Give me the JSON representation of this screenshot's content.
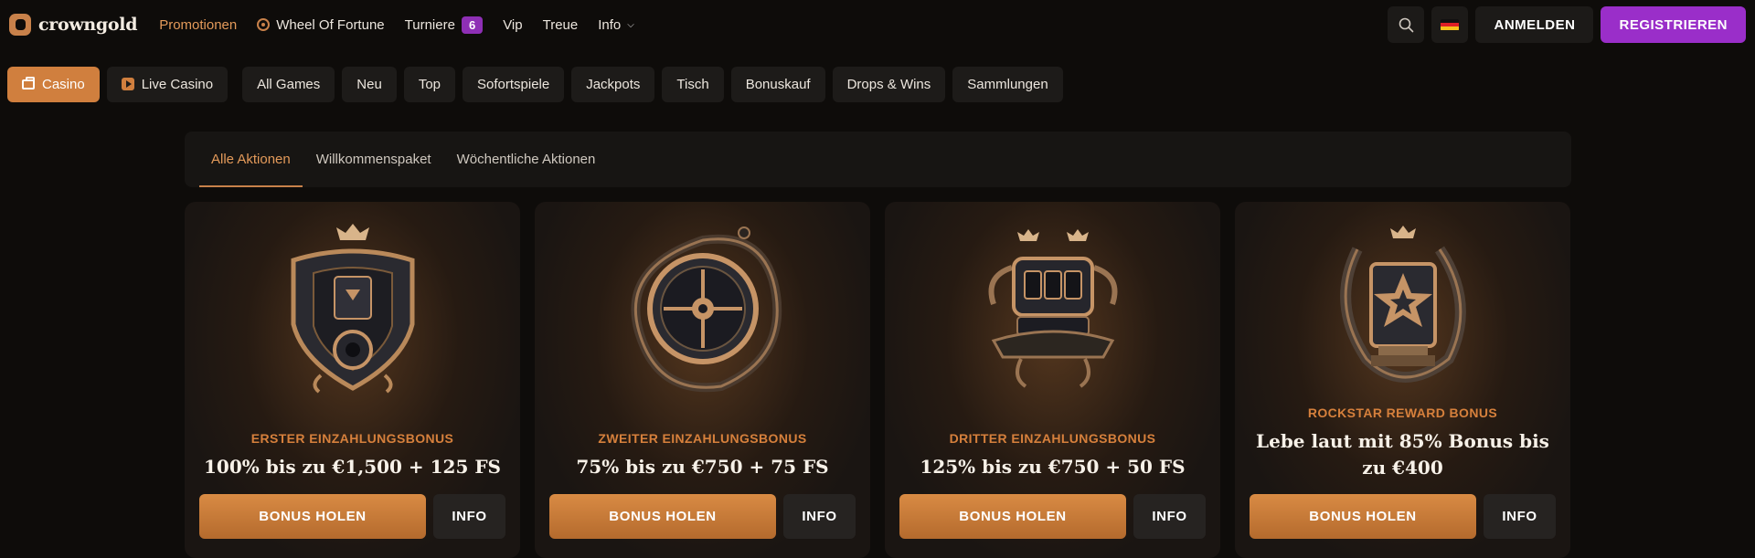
{
  "brand": {
    "name": "crowngold"
  },
  "nav": {
    "promotions": "Promotionen",
    "wheel": "Wheel Of Fortune",
    "tournaments": "Turniere",
    "tournaments_count": "6",
    "vip": "Vip",
    "loyalty": "Treue",
    "info": "Info"
  },
  "header": {
    "login": "ANMELDEN",
    "register": "REGISTRIEREN"
  },
  "categories": {
    "casino": "Casino",
    "live_casino": "Live Casino",
    "items": [
      "All Games",
      "Neu",
      "Top",
      "Sofortspiele",
      "Jackpots",
      "Tisch",
      "Bonuskauf",
      "Drops & Wins",
      "Sammlungen"
    ]
  },
  "tabs": [
    "Alle Aktionen",
    "Willkommenspaket",
    "Wöchentliche Aktionen"
  ],
  "cards": [
    {
      "label": "ERSTER EINZAHLUNGSBONUS",
      "title": "100% bis zu €1,500 + 125 FS",
      "cta": "BONUS HOLEN",
      "info": "INFO"
    },
    {
      "label": "ZWEITER EINZAHLUNGSBONUS",
      "title": "75% bis zu €750 + 75 FS",
      "cta": "BONUS HOLEN",
      "info": "INFO"
    },
    {
      "label": "DRITTER EINZAHLUNGSBONUS",
      "title": "125% bis zu €750 + 50 FS",
      "cta": "BONUS HOLEN",
      "info": "INFO"
    },
    {
      "label": "ROCKSTAR REWARD BONUS",
      "title": "Lebe laut mit 85% Bonus bis zu €400",
      "cta": "BONUS HOLEN",
      "info": "INFO"
    }
  ],
  "colors": {
    "accent": "#d07f3e",
    "register": "#9a2ec9",
    "background": "#0e0c0a"
  }
}
